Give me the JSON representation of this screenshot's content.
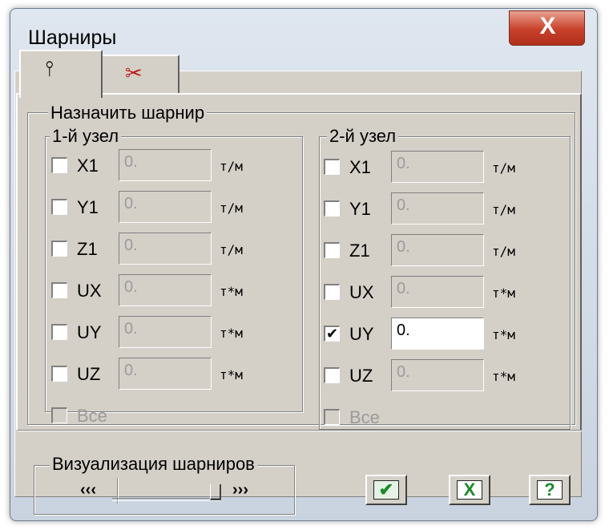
{
  "window": {
    "title": "Шарниры",
    "close_glyph": "X"
  },
  "tabs": [
    {
      "icon": "hinge-icon",
      "glyph": "⫯",
      "color": "#000000"
    },
    {
      "icon": "scissors-icon",
      "glyph": "✂",
      "color": "#c01818"
    }
  ],
  "assign_group": {
    "label": "Назначить шарнир"
  },
  "node1": {
    "label": "1-й узел",
    "rows": [
      {
        "name": "X1",
        "value": "0.",
        "unit": "т/м",
        "checked": false,
        "enabled": false
      },
      {
        "name": "Y1",
        "value": "0.",
        "unit": "т/м",
        "checked": false,
        "enabled": false
      },
      {
        "name": "Z1",
        "value": "0.",
        "unit": "т/м",
        "checked": false,
        "enabled": false
      },
      {
        "name": "UX",
        "value": "0.",
        "unit": "т*м",
        "checked": false,
        "enabled": false
      },
      {
        "name": "UY",
        "value": "0.",
        "unit": "т*м",
        "checked": false,
        "enabled": false
      },
      {
        "name": "UZ",
        "value": "0.",
        "unit": "т*м",
        "checked": false,
        "enabled": false
      }
    ],
    "all_label": "Все"
  },
  "node2": {
    "label": "2-й узел",
    "rows": [
      {
        "name": "X1",
        "value": "0.",
        "unit": "т/м",
        "checked": false,
        "enabled": false
      },
      {
        "name": "Y1",
        "value": "0.",
        "unit": "т/м",
        "checked": false,
        "enabled": false
      },
      {
        "name": "Z1",
        "value": "0.",
        "unit": "т/м",
        "checked": false,
        "enabled": false
      },
      {
        "name": "UX",
        "value": "0.",
        "unit": "т*м",
        "checked": false,
        "enabled": false
      },
      {
        "name": "UY",
        "value": "0.",
        "unit": "т*м",
        "checked": true,
        "enabled": true
      },
      {
        "name": "UZ",
        "value": "0.",
        "unit": "т*м",
        "checked": false,
        "enabled": false
      }
    ],
    "all_label": "Все"
  },
  "visualization": {
    "label": "Визуализация шарниров",
    "left_arrow": "‹‹‹",
    "right_arrow": "›››",
    "level": 1.0
  },
  "buttons": {
    "apply": {
      "icon": "apply-icon",
      "glyph": "✔",
      "color": "#1a8a2a"
    },
    "cancel": {
      "icon": "cancel-icon",
      "glyph": "X",
      "color": "#1a8a2a"
    },
    "help": {
      "icon": "help-icon",
      "glyph": "?",
      "color": "#1a8a2a"
    }
  }
}
